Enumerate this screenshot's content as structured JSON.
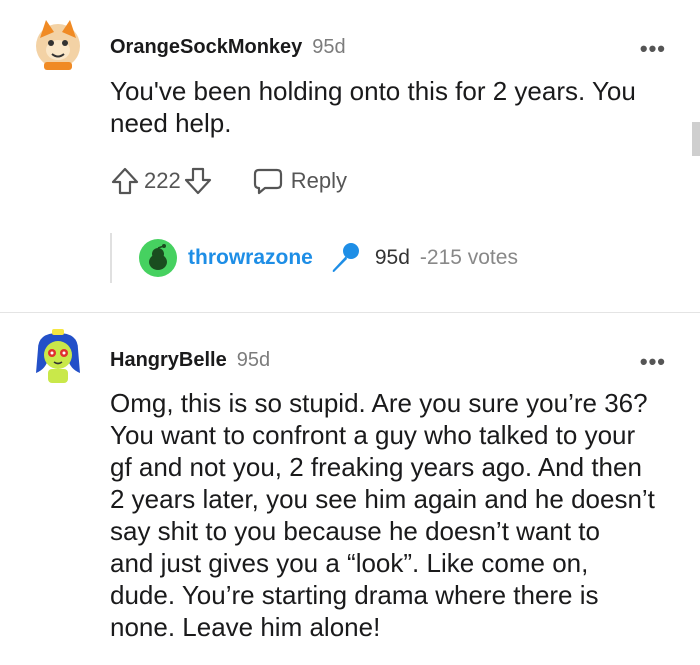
{
  "comments": [
    {
      "username": "OrangeSockMonkey",
      "time": "95d",
      "more": "•••",
      "lines": [
        "You've been holding onto this for 2 years. You",
        "need help."
      ],
      "score": "222",
      "reply_label": "Reply",
      "avatar_icon": "monkey-avatar-icon"
    },
    {
      "username": "HangryBelle",
      "time": "95d",
      "more": "•••",
      "lines": [
        "Omg, this is so stupid. Are you sure you’re 36?",
        "You want to confront a guy who talked to your",
        "gf and not you, 2 freaking years ago. And then",
        "2 years later, you see him again and he doesn’t",
        "say shit to you because he doesn’t want to",
        "and just gives you a “look”. Like come on,",
        "dude. You’re starting drama where there is",
        "none. Leave him alone!"
      ],
      "avatar_icon": "girl-avatar-icon"
    }
  ],
  "collapsed_reply": {
    "username": "throwrazone",
    "time": "95d",
    "votes": "-215 votes",
    "avatar_icon": "snoo-avatar-icon",
    "badge_icon": "microphone-icon"
  },
  "colors": {
    "username_link": "#1e8ee6",
    "avatar_green": "#46d160",
    "text": "#1a1a1b",
    "muted": "#7c7c7c"
  }
}
